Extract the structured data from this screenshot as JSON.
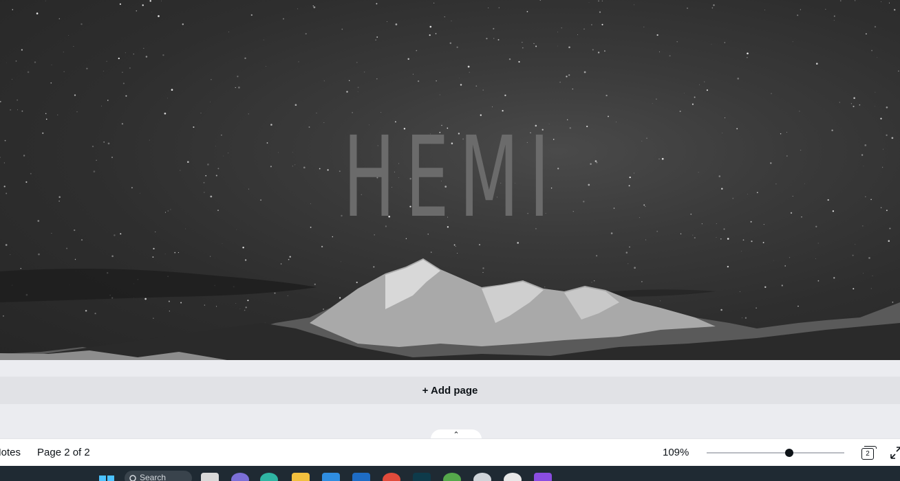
{
  "canvas": {
    "title": "HEMI"
  },
  "add_page": {
    "label": "+ Add page"
  },
  "footer": {
    "notes_label": "Notes",
    "page_indicator": "Page 2 of 2",
    "zoom_value": "109%",
    "zoom_fraction": 0.6,
    "pages_count": "2"
  },
  "taskbar": {
    "search_label": "Search",
    "icons": [
      "windows-start-icon",
      "search-icon",
      "file-explorer-icon",
      "teams-icon",
      "edge-icon",
      "folder-icon",
      "store-icon",
      "mail-icon",
      "chrome-icon",
      "terminal-icon",
      "chrome-canary-icon",
      "clock-icon",
      "settings-icon",
      "clipchamp-icon"
    ]
  },
  "colors": {
    "canvas_bg": "#2e2e2e",
    "title_text": "#6b6b6b",
    "ui_text": "#0e1318",
    "taskbar_bg": "#1f2a33"
  }
}
